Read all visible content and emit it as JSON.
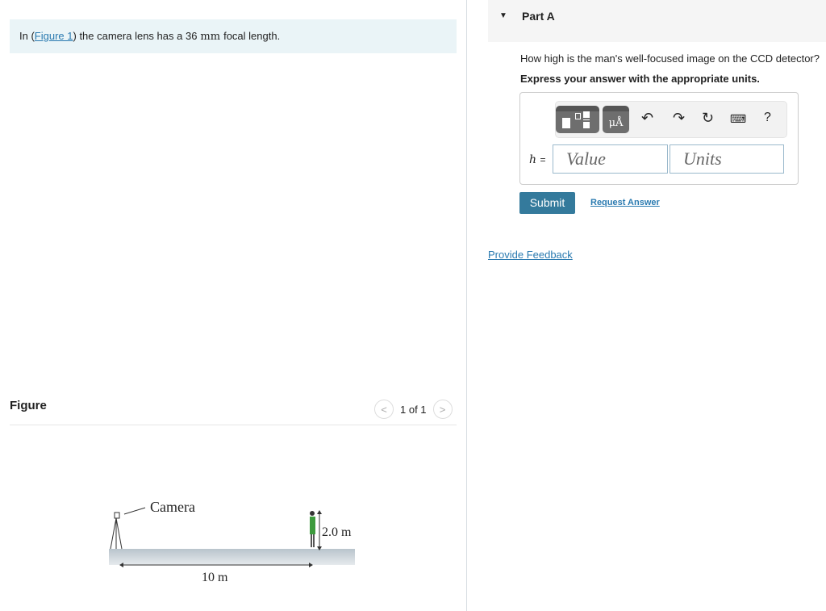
{
  "intro": {
    "prefix": "In (",
    "link": "Figure 1",
    "middle": ") the camera lens has a 36",
    "unit": "mm",
    "suffix": "focal length."
  },
  "figure": {
    "title": "Figure",
    "pager": "1 of 1",
    "prev_icon": "chevron-left-icon",
    "next_icon": "chevron-right-icon",
    "camera_label": "Camera",
    "height_label": "2.0 m",
    "distance_label": "10 m"
  },
  "part": {
    "label": "Part A",
    "question": "How high is the man's well-focused image on the CCD detector?",
    "instruction": "Express your answer with the appropriate units.",
    "variable": "h",
    "equals": "=",
    "value_placeholder": "Value",
    "units_placeholder": "Units",
    "help": "?",
    "units_glyph": "μÅ",
    "submit": "Submit",
    "request_answer": "Request Answer"
  },
  "feedback": "Provide Feedback"
}
